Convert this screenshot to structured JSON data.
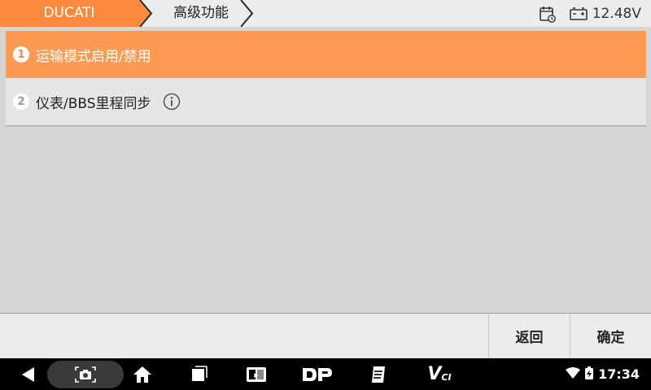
{
  "topbar": {
    "breadcrumbs": [
      "DUCATI",
      "高级功能"
    ],
    "voltage": "12.48V",
    "brand_color": "#ff8a3d"
  },
  "list": {
    "items": [
      {
        "number": "1",
        "label": "运输模式启用/禁用",
        "selected": true,
        "has_info": false
      },
      {
        "number": "2",
        "label": "仪表/BBS里程同步",
        "selected": false,
        "has_info": true
      }
    ]
  },
  "actions": {
    "back_label": "返回",
    "ok_label": "确定"
  },
  "navbar": {
    "icons": [
      "back-icon",
      "screenshot-icon",
      "home-icon",
      "recents-icon",
      "app-icon",
      "dp-icon",
      "clipboard-icon",
      "vci-icon"
    ],
    "vci_text": "V",
    "vci_sub": "CI",
    "time": "17:34"
  }
}
